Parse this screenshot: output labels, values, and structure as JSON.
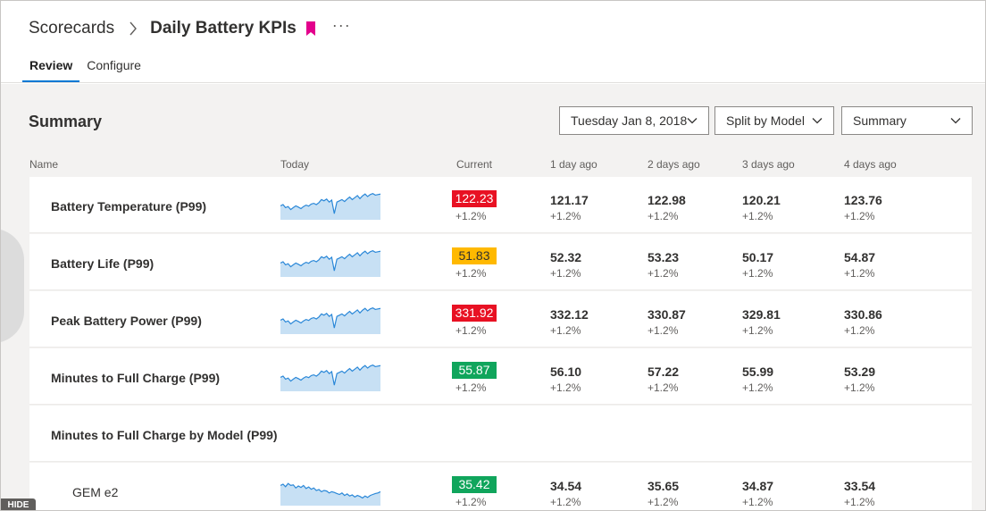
{
  "breadcrumb": {
    "root": "Scorecards",
    "title": "Daily Battery KPIs",
    "more": "···"
  },
  "tabs": [
    {
      "label": "Review",
      "active": true
    },
    {
      "label": "Configure",
      "active": false
    }
  ],
  "summary": {
    "title": "Summary",
    "date_dropdown": "Tuesday Jan 8, 2018",
    "split_dropdown": "Split by Model",
    "view_dropdown": "Summary"
  },
  "columns": {
    "name": "Name",
    "today": "Today",
    "current": "Current",
    "d1": "1 day ago",
    "d2": "2 days ago",
    "d3": "3 days ago",
    "d4": "4 days ago"
  },
  "rows": [
    {
      "name": "Battery Temperature (P99)",
      "current": "122.23",
      "status": "red",
      "current_delta": "+1.2%",
      "d1": "121.17",
      "d1_delta": "+1.2%",
      "d2": "122.98",
      "d2_delta": "+1.2%",
      "d3": "120.21",
      "d3_delta": "+1.2%",
      "d4": "123.76",
      "d4_delta": "+1.2%"
    },
    {
      "name": "Battery Life (P99)",
      "current": "51.83",
      "status": "yellow",
      "current_delta": "+1.2%",
      "d1": "52.32",
      "d1_delta": "+1.2%",
      "d2": "53.23",
      "d2_delta": "+1.2%",
      "d3": "50.17",
      "d3_delta": "+1.2%",
      "d4": "54.87",
      "d4_delta": "+1.2%"
    },
    {
      "name": "Peak Battery Power (P99)",
      "current": "331.92",
      "status": "red",
      "current_delta": "+1.2%",
      "d1": "332.12",
      "d1_delta": "+1.2%",
      "d2": "330.87",
      "d2_delta": "+1.2%",
      "d3": "329.81",
      "d3_delta": "+1.2%",
      "d4": "330.86",
      "d4_delta": "+1.2%"
    },
    {
      "name": "Minutes to Full Charge (P99)",
      "current": "55.87",
      "status": "green",
      "current_delta": "+1.2%",
      "d1": "56.10",
      "d1_delta": "+1.2%",
      "d2": "57.22",
      "d2_delta": "+1.2%",
      "d3": "55.99",
      "d3_delta": "+1.2%",
      "d4": "53.29",
      "d4_delta": "+1.2%"
    }
  ],
  "group_header": "Minutes to Full Charge by Model (P99)",
  "sub_rows": [
    {
      "name": "GEM e2",
      "current": "35.42",
      "status": "green",
      "current_delta": "+1.2%",
      "d1": "34.54",
      "d1_delta": "+1.2%",
      "d2": "35.65",
      "d2_delta": "+1.2%",
      "d3": "34.87",
      "d3_delta": "+1.2%",
      "d4": "33.54",
      "d4_delta": "+1.2%"
    }
  ],
  "hide_label": "HIDE",
  "colors": {
    "accent": "#0078d4",
    "bookmark": "#e3008c",
    "red": "#e81123",
    "yellow": "#ffb900",
    "green": "#10a55c",
    "spark_line": "#2b88d8",
    "spark_fill": "#c7e0f4"
  }
}
